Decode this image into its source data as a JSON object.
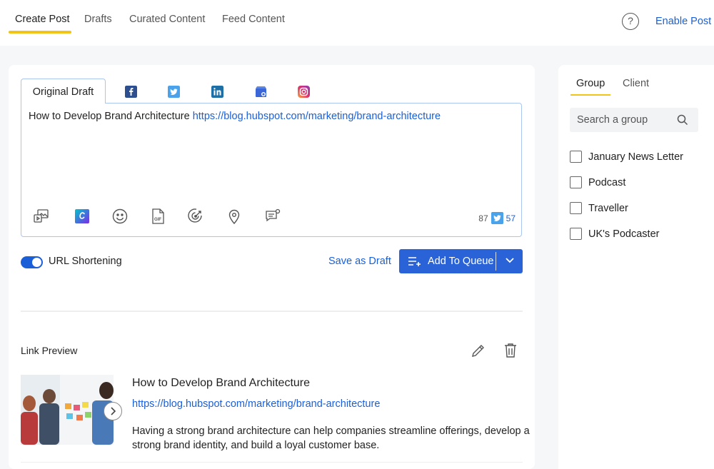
{
  "nav": {
    "tabs": [
      "Create Post",
      "Drafts",
      "Curated Content",
      "Feed Content"
    ],
    "active_tab": "Create Post",
    "help_label": "?",
    "enable_link": "Enable Post F"
  },
  "composer": {
    "original_tab": "Original Draft",
    "networks": [
      "facebook-icon",
      "twitter-icon",
      "linkedin-icon",
      "google-business-icon",
      "instagram-icon"
    ],
    "post_text": "How to Develop Brand Architecture",
    "post_url": "https://blog.hubspot.com/marketing/brand-architecture",
    "tools": [
      "media-icon",
      "canva-icon",
      "emoji-icon",
      "gif-icon",
      "target-icon",
      "location-icon",
      "comment-icon"
    ],
    "char_count": "87",
    "twitter_count": "57"
  },
  "actions": {
    "url_shortening_label": "URL Shortening",
    "url_shortening_on": true,
    "save_draft": "Save as Draft",
    "add_to_queue": "Add To Queue"
  },
  "link_preview": {
    "section_title": "Link Preview",
    "headline": "How to Develop Brand Architecture",
    "url": "https://blog.hubspot.com/marketing/brand-architecture",
    "description": "Having a strong brand architecture can help companies streamline offerings, develop a strong brand identity, and build a loyal customer base."
  },
  "sidebar": {
    "tabs": [
      "Group",
      "Client"
    ],
    "active_tab": "Group",
    "search_placeholder": "Search a group",
    "groups": [
      "January News Letter",
      "Podcast",
      "Traveller",
      "UK's Podcaster"
    ]
  },
  "colors": {
    "accent": "#1a5fd8",
    "tab_underline": "#f0c419",
    "button": "#2a63d8"
  }
}
